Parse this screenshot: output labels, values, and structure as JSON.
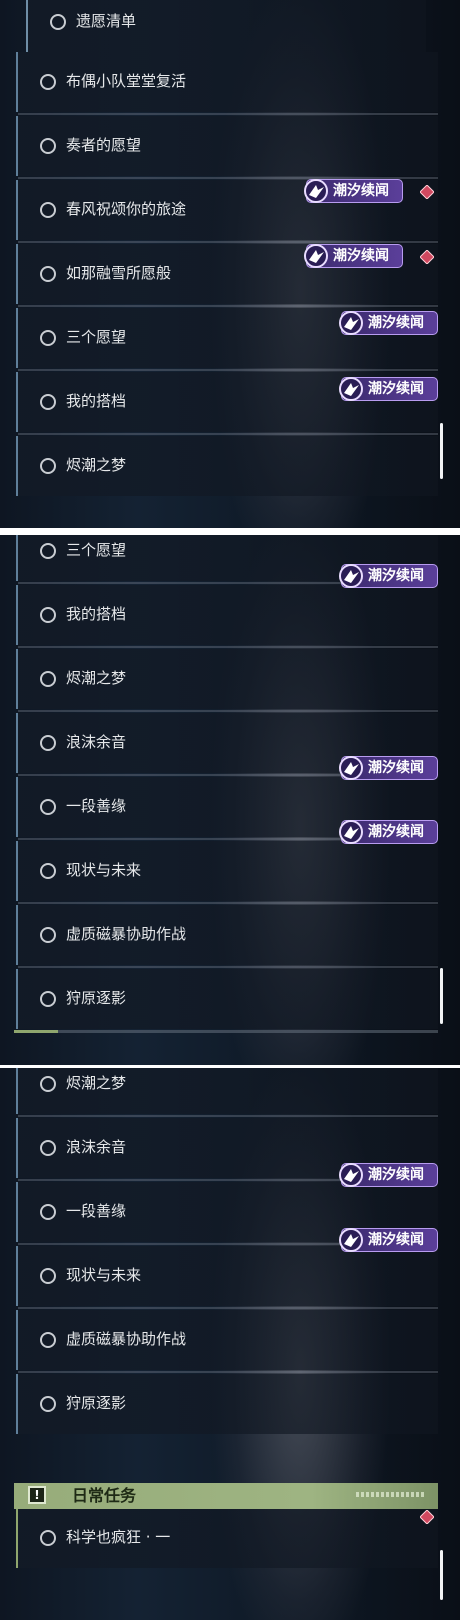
{
  "panel1": {
    "rows": [
      {
        "label": "遗愿清单"
      },
      {
        "label": "布偶小队堂堂复活"
      },
      {
        "label": "奏者的愿望"
      },
      {
        "label": "春风祝颂你的旅途"
      },
      {
        "label": "如那融雪所愿般"
      },
      {
        "label": "三个愿望"
      },
      {
        "label": "我的搭档"
      },
      {
        "label": "烬潮之梦"
      }
    ]
  },
  "panel2": {
    "rows": [
      {
        "label": "三个愿望"
      },
      {
        "label": "我的搭档"
      },
      {
        "label": "烬潮之梦"
      },
      {
        "label": "浪沫余音"
      },
      {
        "label": "一段善缘"
      },
      {
        "label": "现状与未来"
      },
      {
        "label": "虚质磁暴协助作战"
      },
      {
        "label": "狩原逐影"
      }
    ]
  },
  "panel3": {
    "rows": [
      {
        "label": "烬潮之梦"
      },
      {
        "label": "浪沫余音"
      },
      {
        "label": "一段善缘"
      },
      {
        "label": "现状与未来"
      },
      {
        "label": "虚质磁暴协助作战"
      },
      {
        "label": "狩原逐影"
      }
    ],
    "daily_section": {
      "icon": "!",
      "title": "日常任务"
    },
    "daily_rows": [
      {
        "label": "科学也疯狂 · 一"
      }
    ]
  },
  "badge_text": "潮汐续闻",
  "colors": {
    "badge_bg": "#4a3386",
    "badge_border": "#b89cf0",
    "diamond": "#d0485f",
    "daily_header": "#97ac7a",
    "row_accent": "#5f7f9a"
  }
}
